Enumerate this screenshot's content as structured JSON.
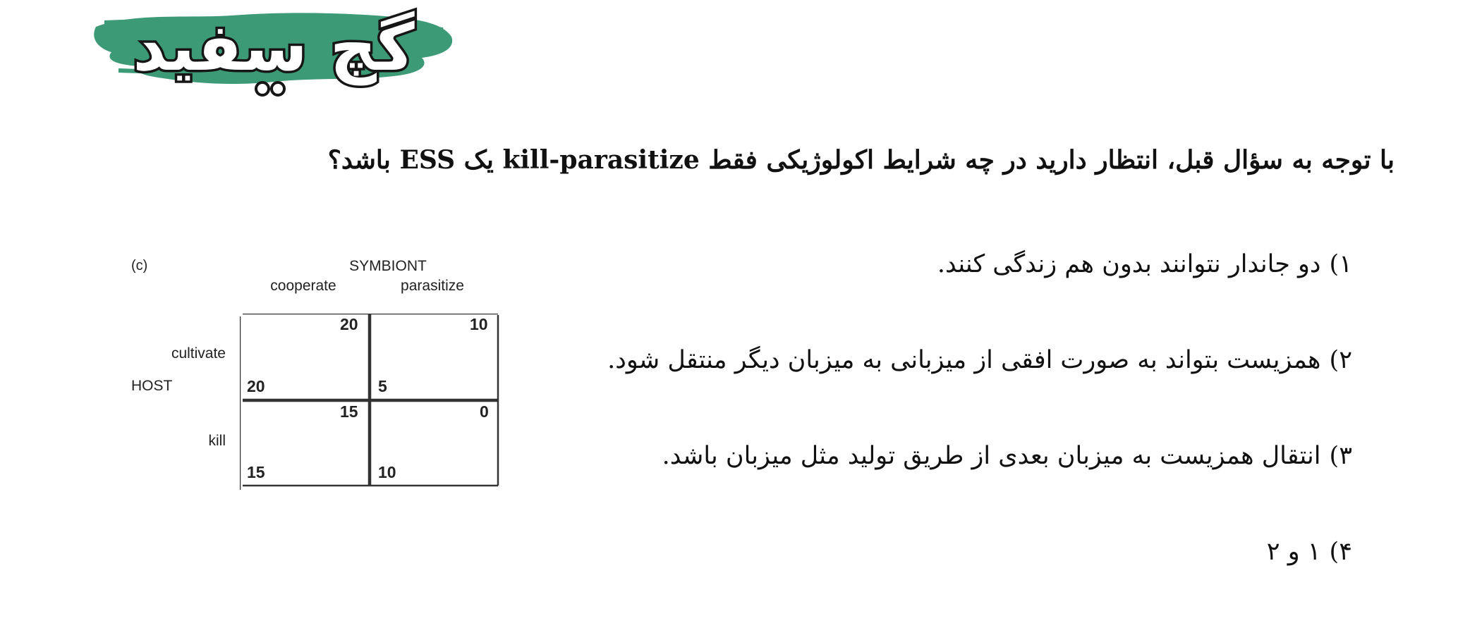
{
  "logo": {
    "text": "گچ سفید",
    "colors": {
      "brush": "#3c9a77",
      "outline": "#161616",
      "letters": "#ffffff"
    }
  },
  "question": {
    "text": "با توجه به سؤال قبل، انتظار دارید در چه شرایط اکولوژیکی فقط kill-parasitize یک ESS باشد؟"
  },
  "options": [
    {
      "number": "۱)",
      "text": "دو جاندار نتوانند بدون هم زندگی کنند."
    },
    {
      "number": "۲)",
      "text": "همزیست بتواند به صورت افقی از میزبانی به میزبان دیگر منتقل شود."
    },
    {
      "number": "۳)",
      "text": "انتقال همزیست به میزبان بعدی از طریق تولید مثل میزبان باشد."
    },
    {
      "number": "۴)",
      "text": "۱ و ۲"
    }
  ],
  "figure": {
    "tag": "(c)",
    "column_header": "SYMBIONT",
    "columns": [
      "cooperate",
      "parasitize"
    ],
    "row_header": "HOST",
    "rows": [
      "cultivate",
      "kill"
    ],
    "cells": [
      [
        {
          "symbiont": "20",
          "host": "20"
        },
        {
          "symbiont": "10",
          "host": "5"
        }
      ],
      [
        {
          "symbiont": "15",
          "host": "15"
        },
        {
          "symbiont": "0",
          "host": "10"
        }
      ]
    ]
  }
}
